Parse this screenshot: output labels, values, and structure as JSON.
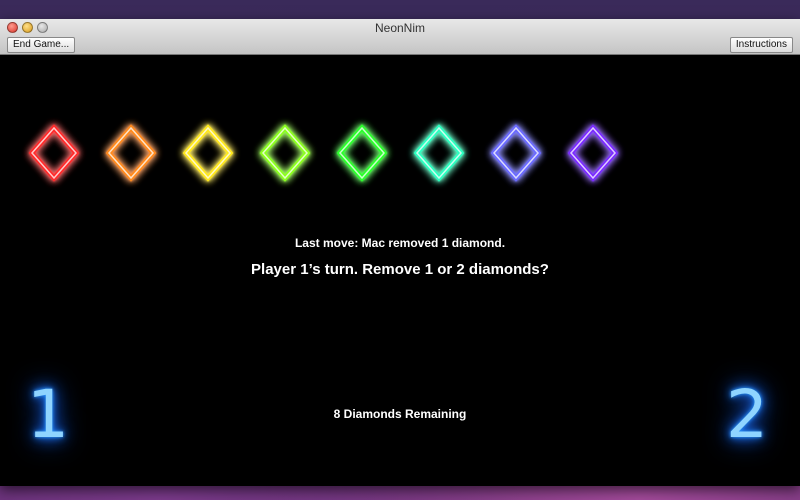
{
  "window": {
    "title": "NeonNim"
  },
  "toolbar": {
    "end_game_label": "End Game...",
    "instructions_label": "Instructions"
  },
  "game": {
    "last_move": "Last move: Mac removed 1 diamond.",
    "turn_prompt": "Player 1’s turn. Remove 1 or 2 diamonds?",
    "remaining": "8 Diamonds Remaining",
    "player_left": "1",
    "player_right": "2",
    "diamonds_remaining": 8,
    "diamond_colors": [
      "#ff2a2a",
      "#ff8a1a",
      "#ffe81a",
      "#8cff1a",
      "#2aff2a",
      "#2affc0",
      "#6a6aff",
      "#7a2aff"
    ]
  },
  "icons": {
    "close": "close-icon",
    "minimize": "minimize-icon",
    "zoom": "zoom-icon",
    "diamond": "diamond-icon"
  }
}
